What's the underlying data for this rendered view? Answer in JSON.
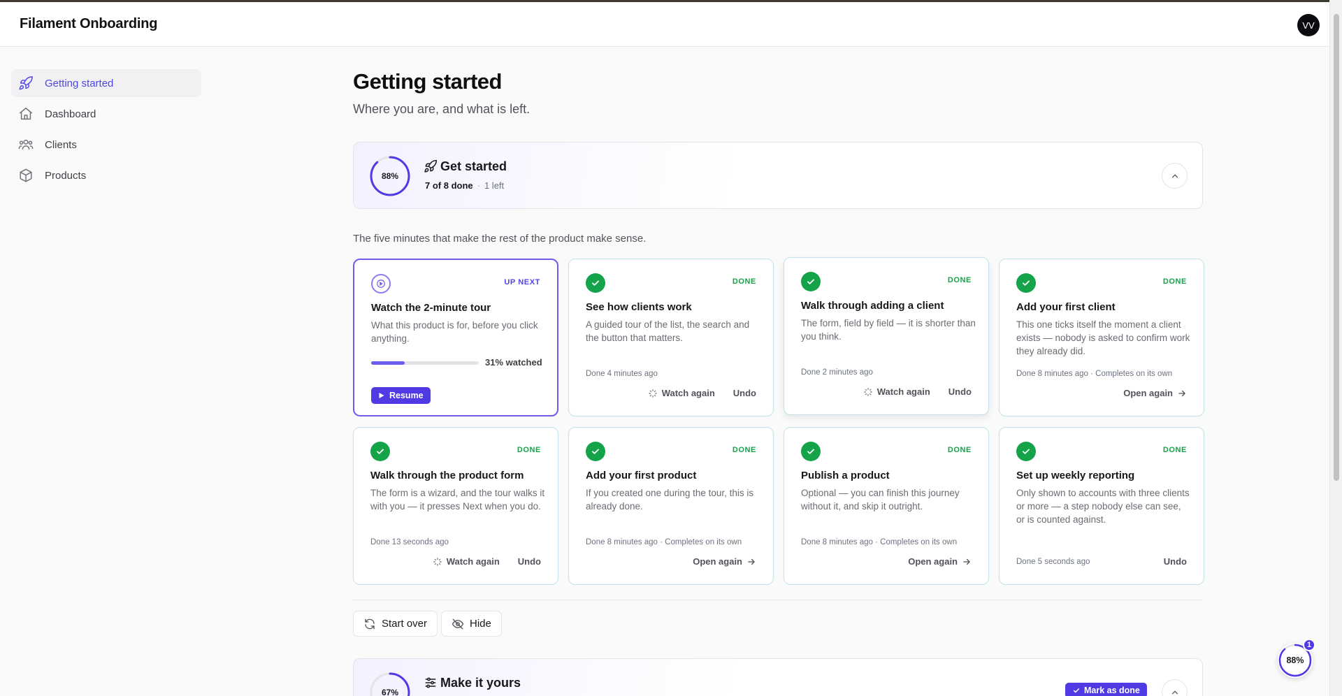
{
  "app": {
    "title": "Filament Onboarding",
    "avatar_initials": "VV"
  },
  "sidebar": {
    "items": [
      {
        "label": "Getting started",
        "icon": "rocket-icon",
        "active": true
      },
      {
        "label": "Dashboard",
        "icon": "home-icon",
        "active": false
      },
      {
        "label": "Clients",
        "icon": "users-icon",
        "active": false
      },
      {
        "label": "Products",
        "icon": "cube-icon",
        "active": false
      }
    ]
  },
  "page": {
    "title": "Getting started",
    "subtitle": "Where you are, and what is left."
  },
  "get_started": {
    "percent_label": "88%",
    "percent": 88,
    "title": "Get started",
    "done_count": "7 of 8 done",
    "remaining": "1 left",
    "intro": "The five minutes that make the rest of the product make sense."
  },
  "cards": [
    {
      "status": "UP NEXT",
      "title": "Watch the 2-minute tour",
      "desc": "What this product is for, before you click anything.",
      "progress": 31,
      "progress_label": "31% watched",
      "resume_label": "Resume"
    },
    {
      "status": "DONE",
      "title": "See how clients work",
      "desc": "A guided tour of the list, the search and the button that matters.",
      "done": "Done 4 minutes ago",
      "actions": [
        "Watch again",
        "Undo"
      ]
    },
    {
      "status": "DONE",
      "title": "Walk through adding a client",
      "desc": "The form, field by field — it is shorter than you think.",
      "done": "Done 2 minutes ago",
      "actions": [
        "Watch again",
        "Undo"
      ]
    },
    {
      "status": "DONE",
      "title": "Add your first client",
      "desc": "This one ticks itself the moment a client exists — nobody is asked to confirm work they already did.",
      "done": "Done 8 minutes ago · Completes on its own",
      "actions": [
        "Open again"
      ]
    },
    {
      "status": "DONE",
      "title": "Walk through the product form",
      "desc": "The form is a wizard, and the tour walks it with you — it presses Next when you do.",
      "done": "Done 13 seconds ago",
      "actions": [
        "Watch again",
        "Undo"
      ]
    },
    {
      "status": "DONE",
      "title": "Add your first product",
      "desc": "If you created one during the tour, this is already done.",
      "done": "Done 8 minutes ago · Completes on its own",
      "actions": [
        "Open again"
      ]
    },
    {
      "status": "DONE",
      "title": "Publish a product",
      "desc": "Optional — you can finish this journey without it, and skip it outright.",
      "done": "Done 8 minutes ago · Completes on its own",
      "actions": [
        "Open again"
      ]
    },
    {
      "status": "DONE",
      "title": "Set up weekly reporting",
      "desc": "Only shown to accounts with three clients or more — a step nobody else can see, or is counted against.",
      "done": "Done 5 seconds ago",
      "actions": [
        "Undo"
      ]
    }
  ],
  "footer_buttons": {
    "start_over": "Start over",
    "hide": "Hide"
  },
  "make_it_yours": {
    "percent_label": "67%",
    "percent": 67,
    "title": "Make it yours",
    "mark_done": "Mark as done"
  },
  "fab": {
    "percent_label": "88%",
    "percent": 88,
    "count": "1"
  },
  "colors": {
    "accent": "#4f3ae3",
    "done": "#15a34a",
    "card_border": "#bfe3ea"
  }
}
